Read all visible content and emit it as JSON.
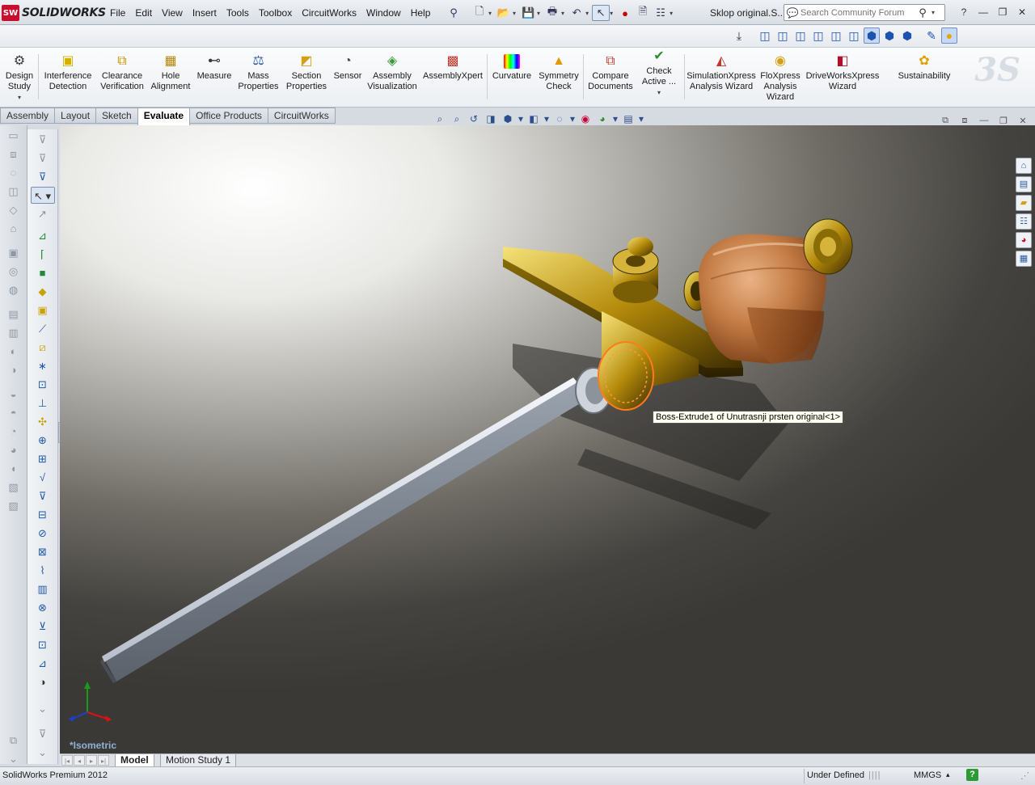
{
  "app": {
    "logo_badge": "SW",
    "logo_text": "SOLIDWORKS",
    "document_name": "Sklop original.S...",
    "brand_color": "#c8102e"
  },
  "menu": [
    "File",
    "Edit",
    "View",
    "Insert",
    "Tools",
    "Toolbox",
    "CircuitWorks",
    "Window",
    "Help"
  ],
  "search": {
    "placeholder": "Search Community Forum"
  },
  "ribbon": {
    "buttons": [
      {
        "label": "Design Study",
        "icon": "design-study-icon"
      },
      {
        "label": "Interference Detection",
        "icon": "interference-detection-icon"
      },
      {
        "label": "Clearance Verification",
        "icon": "clearance-verification-icon"
      },
      {
        "label": "Hole Alignment",
        "icon": "hole-alignment-icon"
      },
      {
        "label": "Measure",
        "icon": "measure-icon"
      },
      {
        "label": "Mass Properties",
        "icon": "mass-properties-icon"
      },
      {
        "label": "Section Properties",
        "icon": "section-properties-icon"
      },
      {
        "label": "Sensor",
        "icon": "sensor-icon"
      },
      {
        "label": "Assembly Visualization",
        "icon": "assembly-visualization-icon"
      },
      {
        "label": "AssemblyXpert",
        "icon": "assemblyxpert-icon"
      },
      {
        "label": "Curvature",
        "icon": "curvature-icon"
      },
      {
        "label": "Symmetry Check",
        "icon": "symmetry-check-icon"
      },
      {
        "label": "Compare Documents",
        "icon": "compare-documents-icon"
      },
      {
        "label": "Check Active ...",
        "icon": "check-active-icon"
      },
      {
        "label": "SimulationXpress Analysis Wizard",
        "icon": "simulationxpress-icon"
      },
      {
        "label": "FloXpress Analysis Wizard",
        "icon": "floxpress-icon"
      },
      {
        "label": "DriveWorksXpress Wizard",
        "icon": "driveworksxpress-icon"
      },
      {
        "label": "Sustainability",
        "icon": "sustainability-icon"
      }
    ]
  },
  "tabs": [
    {
      "label": "Assembly",
      "active": false
    },
    {
      "label": "Layout",
      "active": false
    },
    {
      "label": "Sketch",
      "active": false
    },
    {
      "label": "Evaluate",
      "active": true
    },
    {
      "label": "Office Products",
      "active": false
    },
    {
      "label": "CircuitWorks",
      "active": false
    }
  ],
  "viewport": {
    "tooltip": "Boss-Extrude1 of Unutrasnji prsten original<1>",
    "view_label": "*Isometric"
  },
  "bottom_tabs": [
    {
      "label": "Model",
      "active": true
    },
    {
      "label": "Motion Study 1",
      "active": false
    }
  ],
  "status": {
    "product": "SolidWorks Premium 2012",
    "state": "Under Defined",
    "units": "MMGS",
    "help_glyph": "?"
  }
}
